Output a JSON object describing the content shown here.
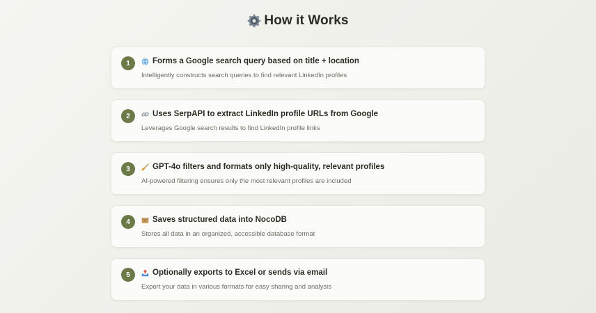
{
  "header": {
    "title": "How it Works",
    "icon": "gear-icon"
  },
  "colors": {
    "badge": "#6b7a47",
    "background": "#f0f0eb",
    "card": "#fbfbf9"
  },
  "steps": [
    {
      "number": "1",
      "icon": "globe-icon",
      "title": "Forms a Google search query based on title + location",
      "description": "Intelligently constructs search queries to find relevant LinkedIn profiles"
    },
    {
      "number": "2",
      "icon": "link-icon",
      "title": "Uses SerpAPI to extract LinkedIn profile URLs from Google",
      "description": "Leverages Google search results to find LinkedIn profile links"
    },
    {
      "number": "3",
      "icon": "broom-icon",
      "title": "GPT-4o filters and formats only high-quality, relevant profiles",
      "description": "AI-powered filtering ensures only the most relevant profiles are included"
    },
    {
      "number": "4",
      "icon": "card-box-icon",
      "title": "Saves structured data into NocoDB",
      "description": "Stores all data in an organized, accessible database format"
    },
    {
      "number": "5",
      "icon": "outbox-tray-icon",
      "title": "Optionally exports to Excel or sends via email",
      "description": "Export your data in various formats for easy sharing and analysis"
    }
  ]
}
